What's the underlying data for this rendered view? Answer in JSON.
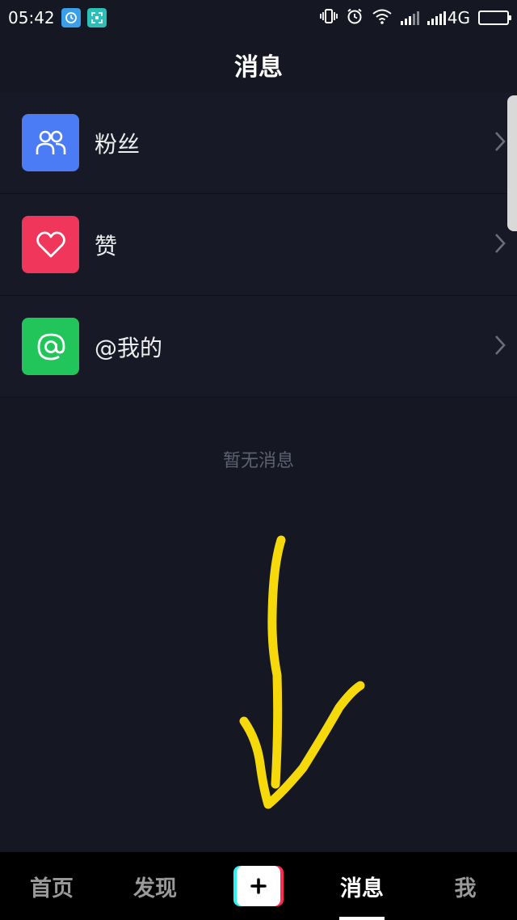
{
  "status_bar": {
    "time": "05:42",
    "network": "4G",
    "icons": [
      "vibrate-icon",
      "alarm-icon",
      "wifi-icon",
      "signal-icon",
      "battery-icon"
    ]
  },
  "header": {
    "title": "消息"
  },
  "list": {
    "items": [
      {
        "label": "粉丝",
        "icon": "fans-icon",
        "color": "#4b7bf5"
      },
      {
        "label": "赞",
        "icon": "heart-icon",
        "color": "#f0365a"
      },
      {
        "label": "@我的",
        "icon": "at-icon",
        "color": "#22c55a"
      }
    ]
  },
  "empty_state": {
    "text": "暂无消息"
  },
  "bottom_nav": {
    "tabs": [
      {
        "label": "首页"
      },
      {
        "label": "发现"
      },
      {
        "label": "消息",
        "active": true
      },
      {
        "label": "我"
      }
    ],
    "publish_icon": "plus-icon"
  },
  "colors": {
    "background": "#151722",
    "list_background": "#171a26",
    "annotation": "#f5d90a"
  }
}
